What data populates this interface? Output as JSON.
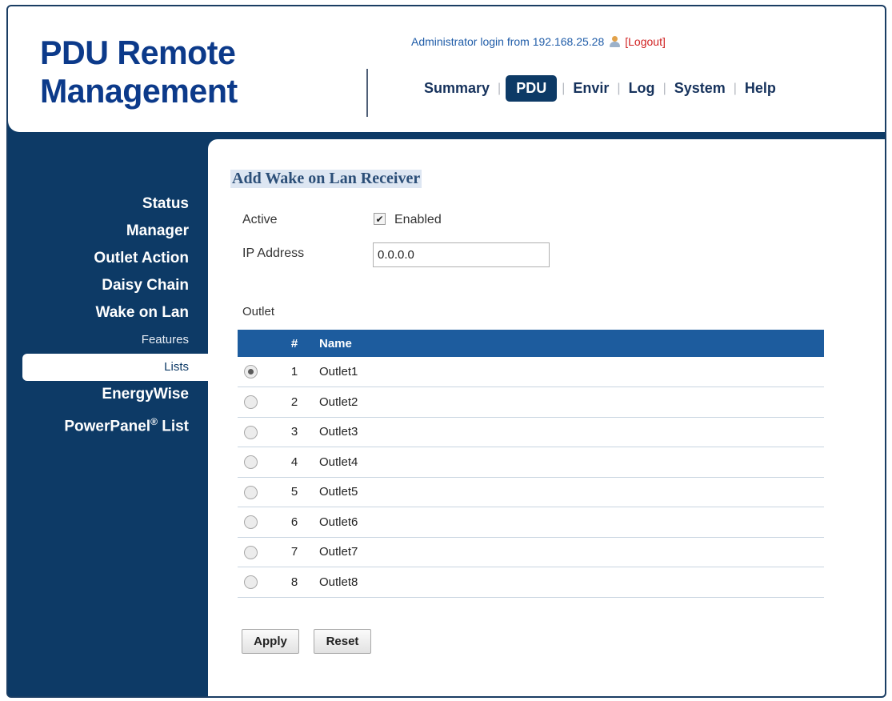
{
  "header": {
    "brand_line1": "PDU Remote",
    "brand_line2": "Management",
    "login_text": "Administrator login from 192.168.25.28",
    "logout_label": "[Logout]",
    "nav": [
      "Summary",
      "PDU",
      "Envir",
      "Log",
      "System",
      "Help"
    ],
    "active_nav": "PDU"
  },
  "sidebar": {
    "items": [
      {
        "label": "Status"
      },
      {
        "label": "Manager"
      },
      {
        "label": "Outlet Action"
      },
      {
        "label": "Daisy Chain"
      },
      {
        "label": "Wake on Lan"
      },
      {
        "label": "Features"
      },
      {
        "label": "Lists"
      },
      {
        "label": "EnergyWise"
      },
      {
        "label": "PowerPanel"
      }
    ],
    "powerpanel_suffix": " List",
    "registered_mark": "®",
    "selected": "Lists"
  },
  "form": {
    "title": "Add Wake on Lan Receiver",
    "active_label": "Active",
    "enabled_label": "Enabled",
    "enabled_checked": true,
    "ip_label": "IP Address",
    "ip_value": "0.0.0.0",
    "outlet_label": "Outlet"
  },
  "table": {
    "headers": [
      "#",
      "Name"
    ],
    "rows": [
      {
        "num": "1",
        "name": "Outlet1",
        "selected": true
      },
      {
        "num": "2",
        "name": "Outlet2",
        "selected": false
      },
      {
        "num": "3",
        "name": "Outlet3",
        "selected": false
      },
      {
        "num": "4",
        "name": "Outlet4",
        "selected": false
      },
      {
        "num": "5",
        "name": "Outlet5",
        "selected": false
      },
      {
        "num": "6",
        "name": "Outlet6",
        "selected": false
      },
      {
        "num": "7",
        "name": "Outlet7",
        "selected": false
      },
      {
        "num": "8",
        "name": "Outlet8",
        "selected": false
      }
    ]
  },
  "buttons": {
    "apply": "Apply",
    "reset": "Reset"
  },
  "icons": {
    "user": "user-icon",
    "check": "checkmark-icon"
  },
  "colors": {
    "brand": "#0c3a8a",
    "navy": "#0d3a66",
    "table_header": "#1d5c9e",
    "logout": "#d02020"
  }
}
